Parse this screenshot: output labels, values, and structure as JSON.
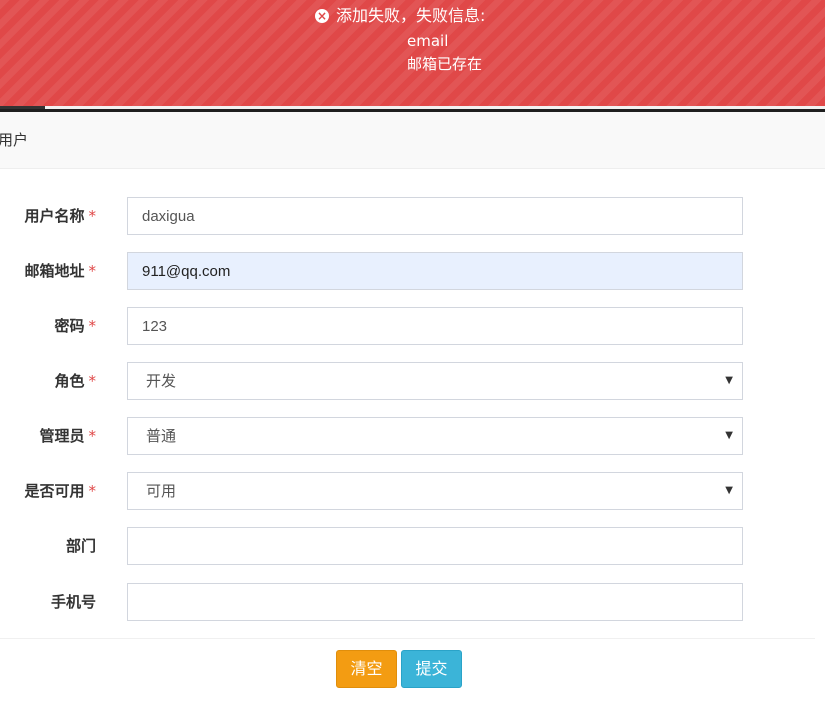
{
  "alert": {
    "title": "添加失败，失败信息:",
    "field": "email",
    "message": "邮箱已存在",
    "color": "#e04848"
  },
  "panel": {
    "title": "用户"
  },
  "form": {
    "username": {
      "label": "用户名称",
      "required": "*",
      "value": "daxigua"
    },
    "email": {
      "label": "邮箱地址",
      "required": "*",
      "value": "911@qq.com"
    },
    "password": {
      "label": "密码",
      "required": "*",
      "value": "123"
    },
    "role": {
      "label": "角色",
      "required": "*",
      "value": "开发"
    },
    "admin": {
      "label": "管理员",
      "required": "*",
      "value": "普通"
    },
    "enabled": {
      "label": "是否可用",
      "required": "*",
      "value": "可用"
    },
    "department": {
      "label": "部门",
      "value": ""
    },
    "phone": {
      "label": "手机号",
      "value": ""
    }
  },
  "buttons": {
    "clear": "清空",
    "submit": "提交"
  },
  "colors": {
    "warning": "#f39c12",
    "info": "#3bb4d8",
    "required": "#e04848"
  }
}
